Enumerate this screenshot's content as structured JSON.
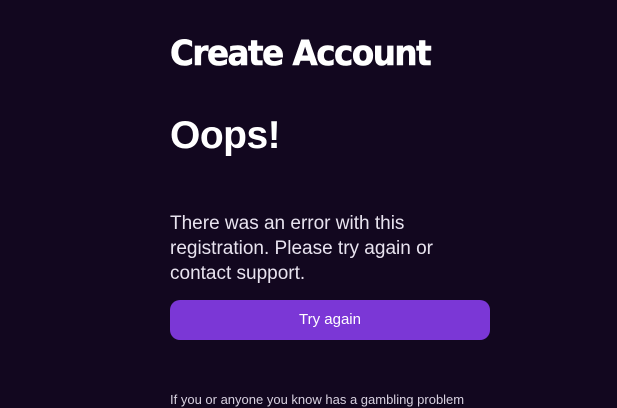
{
  "page": {
    "title": "Create Account",
    "heading": "Oops!",
    "message": "There was an error with this registration. Please try again or contact support."
  },
  "actions": {
    "try_again_label": "Try again"
  },
  "footer": {
    "gambling_notice": "If you or anyone you know has a gambling problem"
  },
  "colors": {
    "background": "#12071f",
    "primary_button": "#7b37d6",
    "text": "#ffffff"
  }
}
